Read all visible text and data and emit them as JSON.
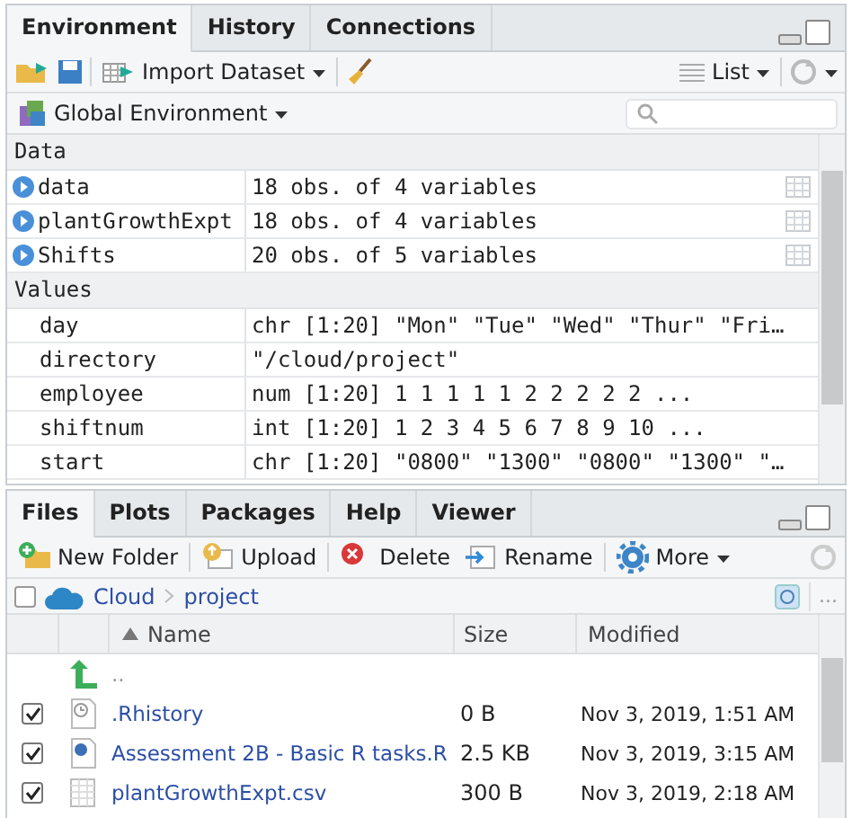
{
  "environment_pane": {
    "tabs": [
      {
        "label": "Environment",
        "selected": true
      },
      {
        "label": "History",
        "selected": false
      },
      {
        "label": "Connections",
        "selected": false
      }
    ],
    "toolbar": {
      "import_label": "Import Dataset",
      "view_label": "List"
    },
    "scope_label": "Global Environment",
    "sections": [
      {
        "title": "Data",
        "rows": [
          {
            "kind": "data",
            "name": "data",
            "value": "18 obs. of 4 variables"
          },
          {
            "kind": "data",
            "name": "plantGrowthExpt",
            "value": "18 obs. of 4 variables"
          },
          {
            "kind": "data",
            "name": "Shifts",
            "value": "20 obs. of 5 variables"
          }
        ]
      },
      {
        "title": "Values",
        "rows": [
          {
            "kind": "value",
            "name": "day",
            "value": "chr [1:20] \"Mon\" \"Tue\" \"Wed\" \"Thur\" \"Fri…"
          },
          {
            "kind": "value",
            "name": "directory",
            "value": "\"/cloud/project\""
          },
          {
            "kind": "value",
            "name": "employee",
            "value": "num [1:20] 1 1 1 1 1 2 2 2 2 2 ..."
          },
          {
            "kind": "value",
            "name": "shiftnum",
            "value": "int [1:20] 1 2 3 4 5 6 7 8 9 10 ..."
          },
          {
            "kind": "value",
            "name": "start",
            "value": "chr [1:20] \"0800\" \"1300\" \"0800\" \"1300\" \"…"
          }
        ]
      }
    ]
  },
  "files_pane": {
    "tabs": [
      {
        "label": "Files",
        "selected": true
      },
      {
        "label": "Plots",
        "selected": false
      },
      {
        "label": "Packages",
        "selected": false
      },
      {
        "label": "Help",
        "selected": false
      },
      {
        "label": "Viewer",
        "selected": false
      }
    ],
    "toolbar": [
      {
        "kind": "newfolder",
        "label": "New Folder"
      },
      {
        "kind": "upload",
        "label": "Upload"
      },
      {
        "kind": "delete",
        "label": "Delete"
      },
      {
        "kind": "rename",
        "label": "Rename"
      },
      {
        "kind": "more",
        "label": "More"
      }
    ],
    "select_all_checked": false,
    "breadcrumb": [
      "Cloud",
      "project"
    ],
    "more_label": "...",
    "columns": [
      "Name",
      "Size",
      "Modified"
    ],
    "rows": [
      {
        "kind": "parent",
        "name": ".."
      },
      {
        "kind": "history",
        "checked": true,
        "name": ".Rhistory",
        "size": "0 B",
        "modified": "Nov 3, 2019, 1:51 AM"
      },
      {
        "kind": "rscript",
        "checked": true,
        "name": "Assessment 2B - Basic R tasks.R",
        "size": "2.5 KB",
        "modified": "Nov 3, 2019, 3:15 AM"
      },
      {
        "kind": "csv",
        "checked": true,
        "name": "plantGrowthExpt.csv",
        "size": "300 B",
        "modified": "Nov 3, 2019, 2:18 AM"
      }
    ]
  }
}
